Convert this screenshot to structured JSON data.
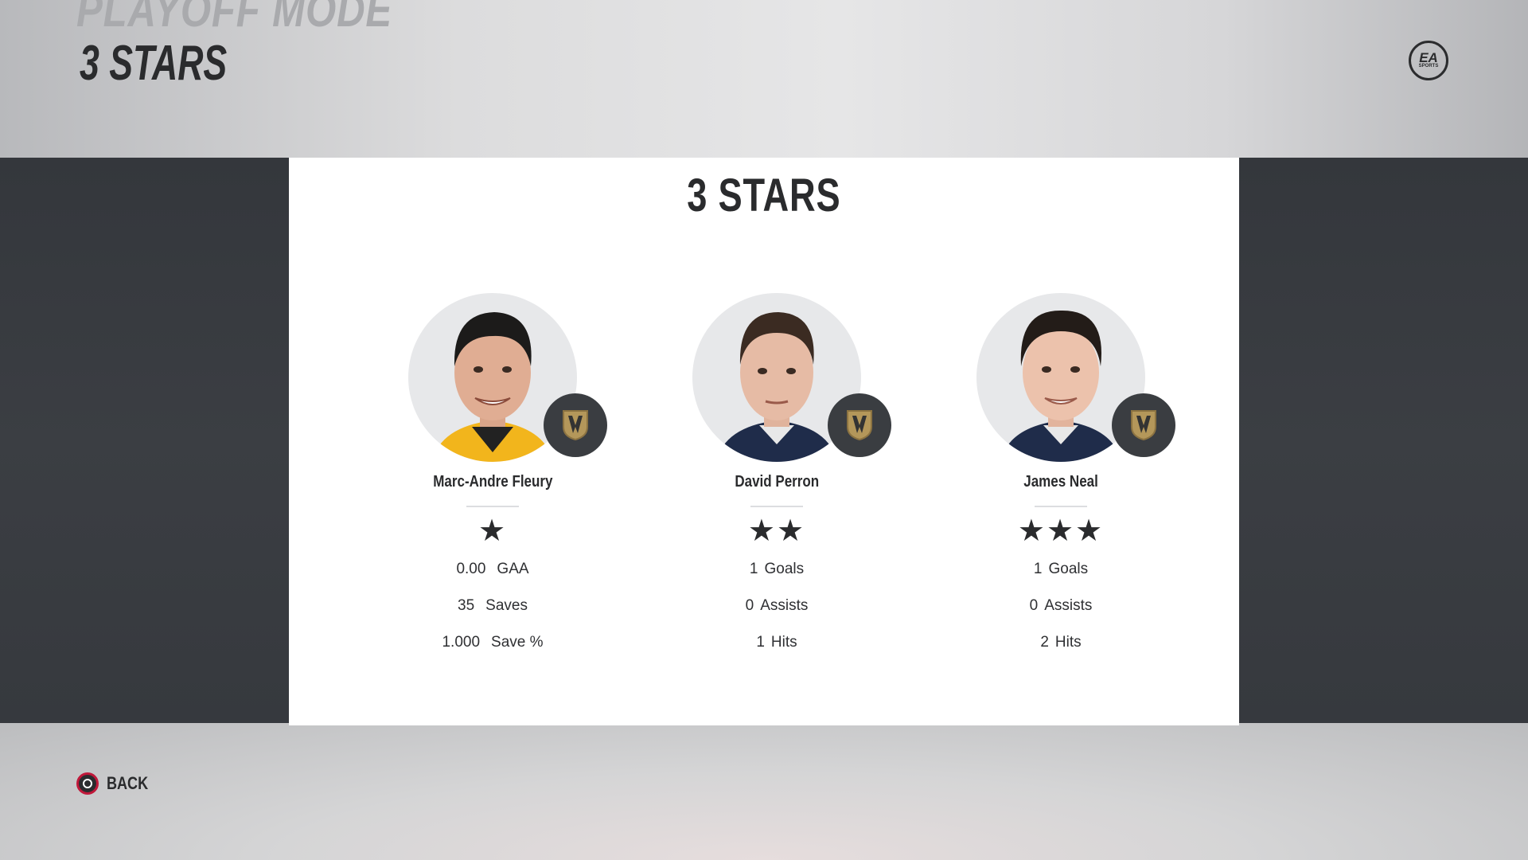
{
  "header": {
    "mode_title": "PLAYOFF MODE",
    "screen_title": "3 STARS",
    "logo_text": "EA",
    "logo_subtext": "SPORTS"
  },
  "panel": {
    "title": "3 STARS"
  },
  "players": [
    {
      "name": "Marc-Andre Fleury",
      "stars": "★",
      "jersey_color": "#f2b51c",
      "stats": [
        {
          "value": "0.00",
          "label": "GAA"
        },
        {
          "value": "35",
          "label": "Saves"
        },
        {
          "value": "1.000",
          "label": "Save %"
        }
      ]
    },
    {
      "name": "David Perron",
      "stars": "★★",
      "jersey_color": "#1f2c4a",
      "stats": [
        {
          "value": "1",
          "label": "Goals"
        },
        {
          "value": "0",
          "label": "Assists"
        },
        {
          "value": "1",
          "label": "Hits"
        }
      ]
    },
    {
      "name": "James Neal",
      "stars": "★★★",
      "jersey_color": "#1f2c4a",
      "stats": [
        {
          "value": "1",
          "label": "Goals"
        },
        {
          "value": "0",
          "label": "Assists"
        },
        {
          "value": "2",
          "label": "Hits"
        }
      ]
    }
  ],
  "footer": {
    "back_label": "BACK",
    "back_button_icon": "circle-button-icon"
  },
  "colors": {
    "accent_red": "#c0183a",
    "dark_band": "#3a3d42",
    "badge_gold": "#b4975a"
  }
}
